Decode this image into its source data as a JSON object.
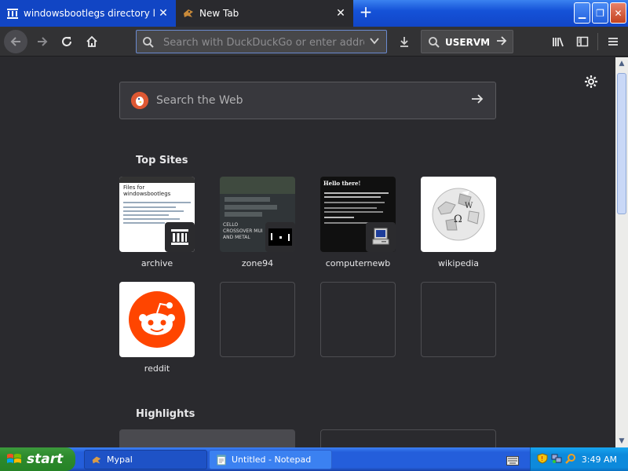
{
  "browser": {
    "tabs": [
      {
        "label": "windowsbootlegs directory listing",
        "active": false
      },
      {
        "label": "New Tab",
        "active": true
      }
    ],
    "url_placeholder": "Search with DuckDuckGo or enter address",
    "search_engine_label": "USERVM"
  },
  "newtab": {
    "search_placeholder": "Search the Web",
    "top_sites_title": "Top Sites",
    "highlights_title": "Highlights",
    "sites": [
      {
        "label": "archive",
        "thumb_heading": "Files for windowsbootlegs"
      },
      {
        "label": "zone94",
        "thumb_heading": "CELLO CROSSOVER MUI AND METAL"
      },
      {
        "label": "computernewb",
        "thumb_heading": "Hello there!"
      },
      {
        "label": "wikipedia"
      },
      {
        "label": "reddit"
      }
    ]
  },
  "taskbar": {
    "start_label": "start",
    "tasks": [
      {
        "label": "Mypal",
        "active": true
      },
      {
        "label": "Untitled - Notepad",
        "active": false
      }
    ],
    "clock": "3:49 AM"
  },
  "colors": {
    "titlebar_blue": "#1552d8",
    "page_bg": "#2a2a2e",
    "ddg_orange": "#de5833",
    "reddit_orange": "#ff4500",
    "xp_start_green": "#2d8a2d"
  }
}
